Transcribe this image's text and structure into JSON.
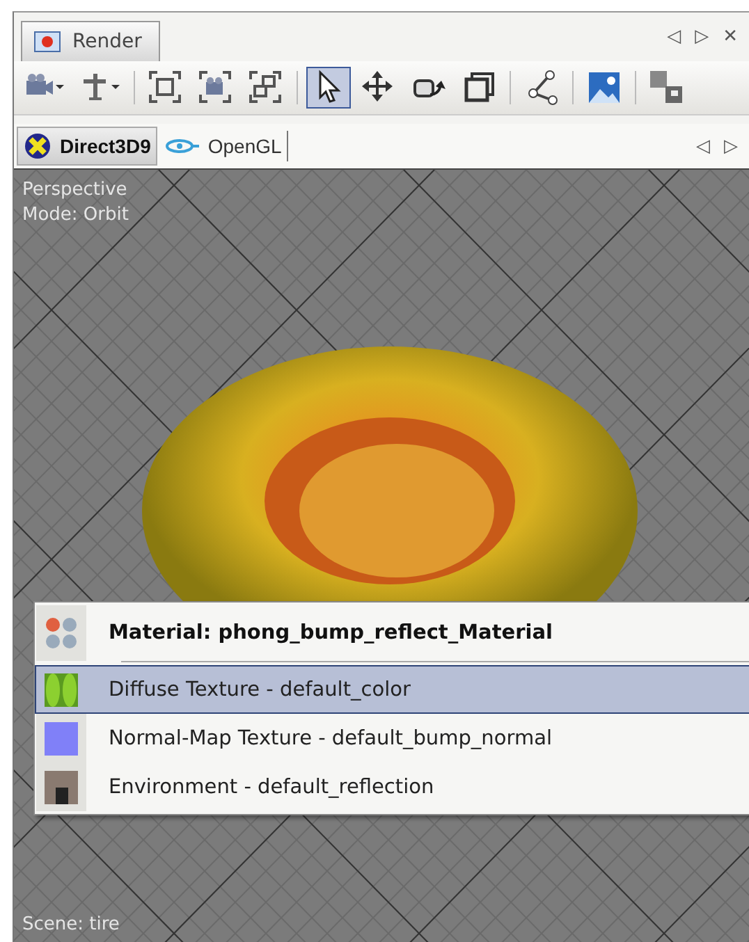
{
  "window": {
    "tab": {
      "title": "Render",
      "selected": true
    },
    "nav": [
      "◁",
      "▷",
      "✕"
    ]
  },
  "toolbar": [
    {
      "kind": "dropdown",
      "selected": false
    },
    {
      "kind": "dropdown",
      "selected": false
    },
    {
      "kind": "separator"
    },
    {
      "kind": "button",
      "selected": false
    },
    {
      "kind": "button",
      "selected": false
    },
    {
      "kind": "button",
      "selected": false
    },
    {
      "kind": "separator"
    },
    {
      "kind": "button",
      "selected": true
    },
    {
      "kind": "button",
      "selected": false
    },
    {
      "kind": "button",
      "selected": false
    },
    {
      "kind": "button",
      "selected": false
    },
    {
      "kind": "separator"
    },
    {
      "kind": "button",
      "selected": false
    },
    {
      "kind": "separator"
    },
    {
      "kind": "button",
      "selected": false
    },
    {
      "kind": "separator"
    },
    {
      "kind": "button",
      "selected": false
    }
  ],
  "renderer_tabs": [
    {
      "label": "Direct3D9",
      "selected": true
    },
    {
      "label": "OpenGL",
      "selected": false
    }
  ],
  "renderer_nav": [
    "◁",
    "▷"
  ],
  "viewport": {
    "labels": [
      "Perspective",
      "Mode: Orbit"
    ],
    "footer": "Scene: tire"
  },
  "menu": {
    "title": "Material: phong_bump_reflect_Material",
    "items": [
      {
        "label": "Diffuse Texture - default_color",
        "selected": true
      },
      {
        "label": "Normal-Map Texture - default_bump_normal",
        "selected": false
      },
      {
        "label": "Environment - default_reflection",
        "selected": false
      }
    ]
  }
}
